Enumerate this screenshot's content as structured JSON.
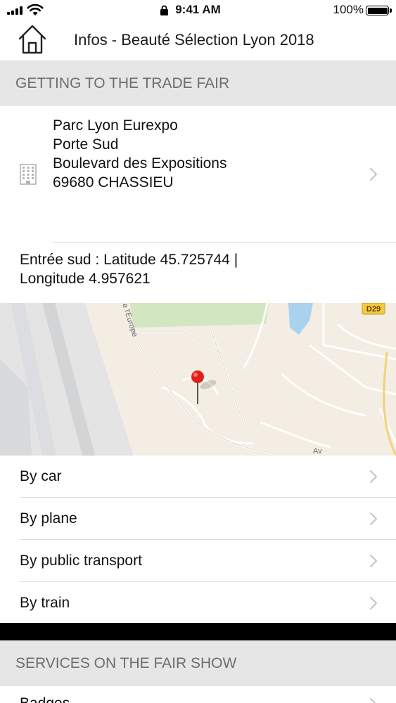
{
  "status_bar": {
    "time": "9:41 AM",
    "battery_percent": "100%",
    "battery_level": 1.0,
    "signal_bars": 4
  },
  "nav": {
    "title": "Infos - Beauté Sélection Lyon 2018",
    "home_icon": "home-icon"
  },
  "getting_there": {
    "header": "GETTING TO THE TRADE FAIR",
    "address": {
      "icon": "building-icon",
      "line1": "Parc Lyon Eurexpo",
      "line2": "Porte Sud",
      "line3": "Boulevard des Expositions",
      "line4": "69680 CHASSIEU"
    },
    "coordinates": {
      "line1": "Entrée sud : Latitude 45.725744 |",
      "line2": "Longitude 4.957621"
    },
    "map": {
      "road_label": "D29",
      "street_label": "e l'Europe",
      "street_label_2": "Av",
      "pin_icon": "map-pin-icon"
    },
    "options": [
      {
        "label": "By car"
      },
      {
        "label": "By plane"
      },
      {
        "label": "By public transport"
      },
      {
        "label": "By train"
      }
    ]
  },
  "services": {
    "header": "SERVICES ON THE FAIR SHOW",
    "first_item": "Badges"
  },
  "colors": {
    "section_bg": "#e6e6e7",
    "section_text": "#6d6d72",
    "chevron": "#c4c4c8",
    "pin": "#e0201b"
  }
}
